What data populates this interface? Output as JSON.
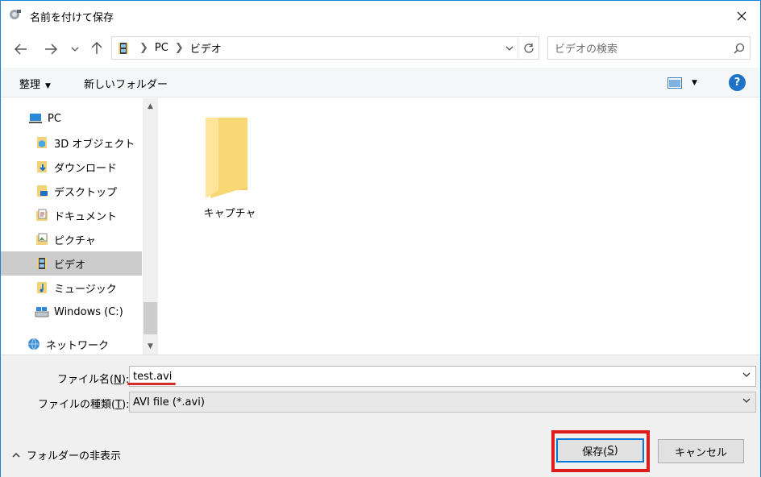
{
  "window": {
    "title": "名前を付けて保存"
  },
  "address": {
    "segments": [
      "PC",
      "ビデオ"
    ]
  },
  "search": {
    "placeholder": "ビデオの検索"
  },
  "toolbar": {
    "organize": "整理",
    "new_folder": "新しいフォルダー"
  },
  "sidebar": {
    "items": [
      {
        "label": "PC",
        "icon": "pc-icon"
      },
      {
        "label": "3D オブジェクト",
        "icon": "3d-objects-icon"
      },
      {
        "label": "ダウンロード",
        "icon": "download-folder-icon"
      },
      {
        "label": "デスクトップ",
        "icon": "desktop-folder-icon"
      },
      {
        "label": "ドキュメント",
        "icon": "documents-folder-icon"
      },
      {
        "label": "ピクチャ",
        "icon": "pictures-folder-icon"
      },
      {
        "label": "ビデオ",
        "icon": "videos-folder-icon",
        "selected": true
      },
      {
        "label": "ミュージック",
        "icon": "music-folder-icon"
      },
      {
        "label": "Windows (C:)",
        "icon": "drive-icon"
      },
      {
        "label": "ネットワーク",
        "icon": "network-icon"
      }
    ]
  },
  "content": {
    "folders": [
      {
        "name": "キャプチャ"
      }
    ]
  },
  "form": {
    "filename_label_pre": "ファイル名(",
    "filename_label_key": "N",
    "filename_label_post": "):",
    "filename_value": "test.avi",
    "filetype_label_pre": "ファイルの種類(",
    "filetype_label_key": "T",
    "filetype_label_post": "):",
    "filetype_value": "AVI file (*.avi)"
  },
  "footer": {
    "hide_folders": "フォルダーの非表示",
    "save_pre": "保存(",
    "save_key": "S",
    "save_post": ")",
    "cancel": "キャンセル"
  },
  "colors": {
    "accent": "#0078d7",
    "highlight_red": "#e01b1b",
    "folder_yellow": "#f8d775"
  }
}
